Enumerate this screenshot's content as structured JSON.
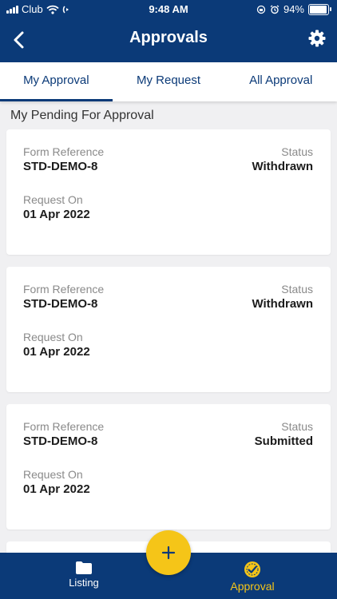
{
  "status_bar": {
    "carrier": "Club",
    "time": "9:48 AM",
    "battery_text": "94%",
    "battery_level": 0.94
  },
  "header": {
    "title": "Approvals",
    "back_icon": "chevron-left-icon",
    "settings_icon": "gear-icon"
  },
  "tabs": [
    {
      "label": "My  Approval",
      "active": true
    },
    {
      "label": "My  Request",
      "active": false
    },
    {
      "label": "All Approval",
      "active": false
    }
  ],
  "section_title": "My Pending For Approval",
  "cards": [
    {
      "ref_label": "Form Reference",
      "ref_value": "STD-DEMO-8",
      "status_label": "Status",
      "status_value": "Withdrawn",
      "req_label": "Request On",
      "req_value": "01 Apr 2022"
    },
    {
      "ref_label": "Form Reference",
      "ref_value": "STD-DEMO-8",
      "status_label": "Status",
      "status_value": "Withdrawn",
      "req_label": "Request On",
      "req_value": "01 Apr 2022"
    },
    {
      "ref_label": "Form Reference",
      "ref_value": "STD-DEMO-8",
      "status_label": "Status",
      "status_value": "Submitted",
      "req_label": "Request On",
      "req_value": "01 Apr 2022"
    }
  ],
  "fab": {
    "icon": "plus-icon"
  },
  "bottom_nav": [
    {
      "label": "Listing",
      "icon": "folder-icon",
      "active": false
    },
    {
      "label": "Approval",
      "icon": "check-badge-icon",
      "active": true
    }
  ],
  "colors": {
    "primary": "#0b3a78",
    "accent": "#f5c518",
    "background": "#f0f0f2"
  }
}
